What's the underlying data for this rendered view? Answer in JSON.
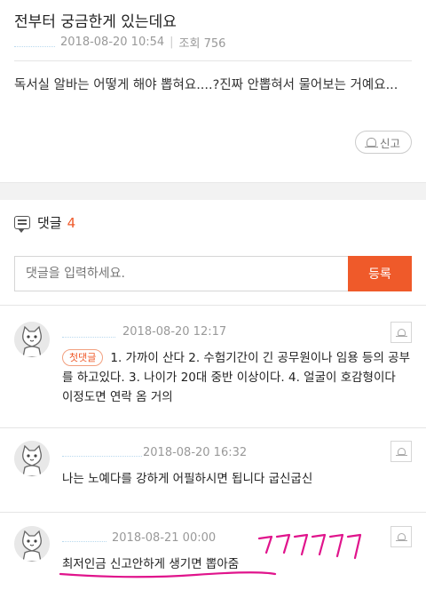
{
  "post": {
    "title": "전부터 궁금한게 있는데요",
    "date": "2018-08-20 10:54",
    "views": "조회 756",
    "body": "독서실 알바는 어떻게 해야 뽑혀요....?진짜 안뽑혀서 물어보는 거예요...",
    "report_label": "신고"
  },
  "comments_section": {
    "label": "댓글",
    "count": "4",
    "input_placeholder": "댓글을 입력하세요.",
    "submit_label": "등록"
  },
  "comments": [
    {
      "date": "2018-08-20 12:17",
      "badge": "첫댓글",
      "text": "1. 가까이 산다 2. 수험기간이 긴 공무원이나 임용 등의 공부를 하고있다. 3. 나이가 20대 중반 이상이다. 4. 얼굴이 호감형이다 이정도면 연락 옴 거의"
    },
    {
      "date": "2018-08-20 16:32",
      "text": "나는 노예다를 강하게 어필하시면 됩니다 굽신굽신"
    },
    {
      "date": "2018-08-21 00:00",
      "text": "최저인금 신고안하게 생기면 뽑아줌"
    }
  ],
  "colors": {
    "accent": "#ef5a2a",
    "muted_text": "#999999",
    "annotation": "#e0148c"
  },
  "icons": {
    "report": "bell-icon",
    "comments": "speech-bubble-icon",
    "avatar": "cat-avatar-icon"
  }
}
